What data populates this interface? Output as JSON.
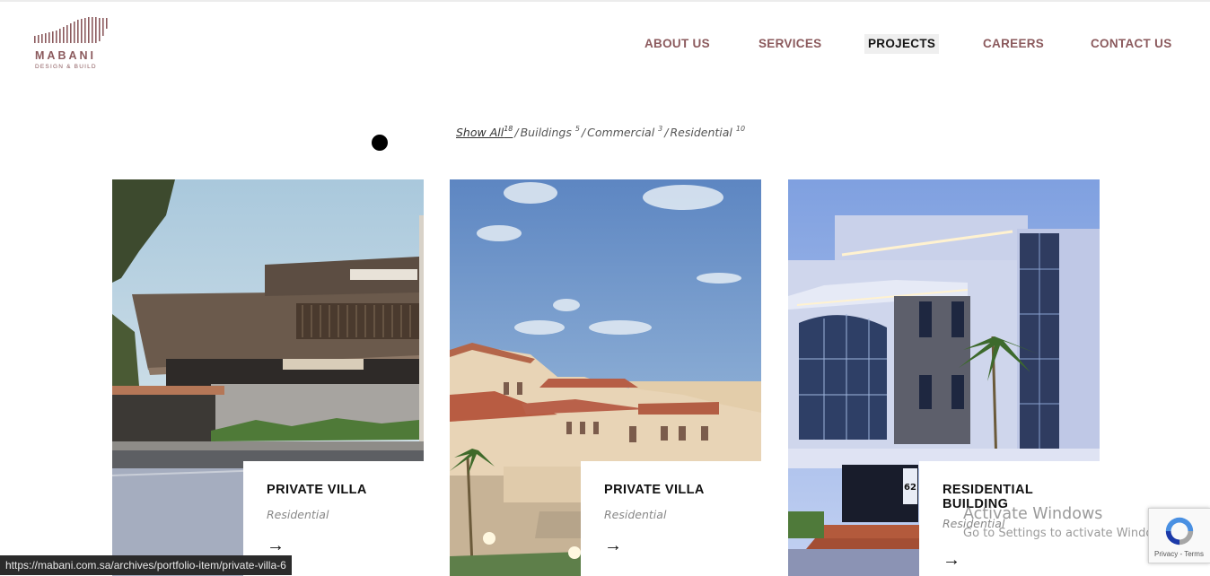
{
  "brand": {
    "name": "MABANI",
    "tagline": "DESIGN & BUILD",
    "color": "#8b5a5d"
  },
  "nav": {
    "items": [
      {
        "label": "ABOUT US"
      },
      {
        "label": "SERVICES"
      },
      {
        "label": "PROJECTS",
        "active": true
      },
      {
        "label": "CAREERS"
      },
      {
        "label": "CONTACT US"
      }
    ]
  },
  "filters": {
    "items": [
      {
        "label": "Show All",
        "count": "18",
        "active": true
      },
      {
        "label": "Buildings",
        "count": "5"
      },
      {
        "label": "Commercial",
        "count": "3"
      },
      {
        "label": "Residential",
        "count": "10"
      }
    ],
    "separator": "/"
  },
  "projects": [
    {
      "title": "PRIVATE VILLA",
      "category": "Residential",
      "arrow": "→"
    },
    {
      "title": "PRIVATE VILLA",
      "category": "Residential",
      "arrow": "→"
    },
    {
      "title": "RESIDENTIAL BUILDING",
      "category": "Residential",
      "arrow": "→"
    }
  ],
  "watermark": {
    "line1": "Activate Windows",
    "line2": "Go to Settings to activate Windows."
  },
  "recaptcha": {
    "links": "Privacy - Terms"
  },
  "status_bar": {
    "url": "https://mabani.com.sa/archives/portfolio-item/private-villa-6"
  },
  "house_number": "62"
}
